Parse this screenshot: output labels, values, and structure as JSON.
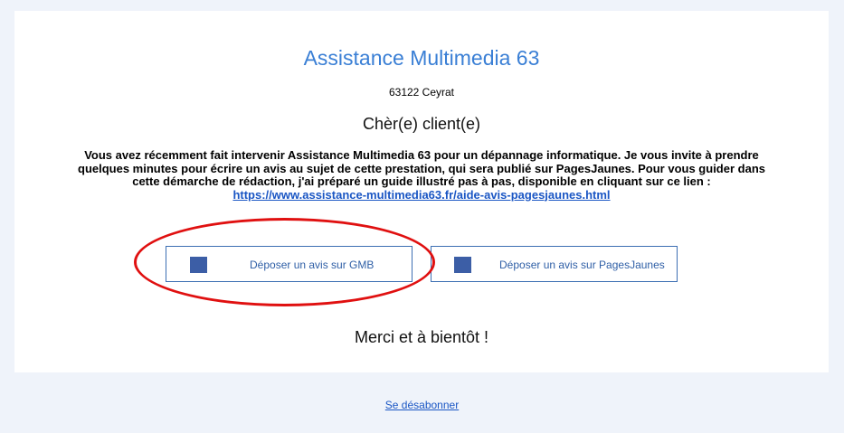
{
  "header": {
    "title": "Assistance Multimedia 63",
    "address": "63122 Ceyrat"
  },
  "body": {
    "greeting": "Chèr(e) client(e)",
    "message_line1": "Vous avez récemment fait intervenir Assistance Multimedia 63 pour un dépannage informatique. Je vous invite à prendre",
    "message_line2": "quelques minutes pour écrire un avis au sujet de cette prestation, qui sera publié sur PagesJaunes. Pour vous guider dans",
    "message_line3": "cette démarche de rédaction, j'ai préparé un guide illustré pas à pas, disponible en cliquant sur ce lien :",
    "guide_link": "https://www.assistance-multimedia63.fr/aide-avis-pagesjaunes.html",
    "thanks": "Merci et à bientôt !"
  },
  "buttons": {
    "gmb_label": "Déposer un avis sur GMB",
    "pj_label": "Déposer un avis sur PagesJaunes"
  },
  "footer": {
    "unsubscribe": "Se désabonner"
  },
  "colors": {
    "title": "#3a7fd5",
    "button_border": "#3d6fb3",
    "icon": "#3c5ea6",
    "highlight_circle": "#e01010",
    "page_background": "#eff3fa"
  }
}
